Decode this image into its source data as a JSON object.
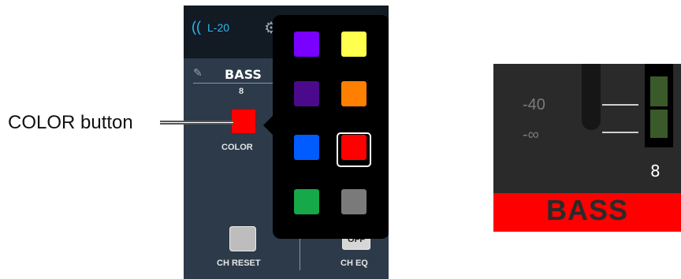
{
  "callout": {
    "label": "COLOR button"
  },
  "app": {
    "device_name": "L-20"
  },
  "channel": {
    "name": "BASS",
    "number": "8",
    "color_label": "COLOR",
    "color": "#ff0000"
  },
  "buttons": {
    "ch_reset_label": "CH RESET",
    "ch_eq_label": "CH EQ",
    "ch_eq_state": "OFF"
  },
  "color_popup": {
    "swatches": [
      {
        "color": "#7a00ff"
      },
      {
        "color": "#ffff4d"
      },
      {
        "color": "#4b0a8c"
      },
      {
        "color": "#ff7f00"
      },
      {
        "color": "#005cff"
      },
      {
        "color": "#ff0000",
        "selected": true
      },
      {
        "color": "#17a84a"
      },
      {
        "color": "#7a7a7a"
      }
    ]
  },
  "channel_strip": {
    "scale_top": "-40",
    "scale_bottom": "-∞",
    "number": "8",
    "name": "BASS"
  },
  "icons": {
    "wireless": "wireless-icon",
    "gear": "gear-icon",
    "edit": "pencil-icon"
  }
}
